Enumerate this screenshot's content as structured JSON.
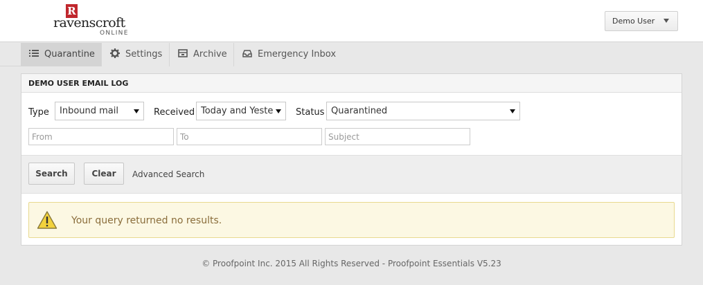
{
  "header": {
    "logo": {
      "mark": "R",
      "word": "ravenscroft",
      "sub": "ONLINE"
    },
    "user_menu": {
      "label": "Demo User",
      "icon": "caret-down-icon"
    }
  },
  "nav": {
    "tabs": [
      {
        "label": "Quarantine",
        "icon": "list-icon",
        "active": true
      },
      {
        "label": "Settings",
        "icon": "gear-icon",
        "active": false
      },
      {
        "label": "Archive",
        "icon": "archive-icon",
        "active": false
      },
      {
        "label": "Emergency Inbox",
        "icon": "inbox-icon",
        "active": false
      }
    ]
  },
  "panel": {
    "title": "DEMO USER EMAIL LOG",
    "filters": {
      "type": {
        "label": "Type",
        "value": "Inbound mail"
      },
      "received": {
        "label": "Received",
        "value": "Today and Yesterday"
      },
      "status": {
        "label": "Status",
        "value": "Quarantined"
      }
    },
    "fields": {
      "from": {
        "placeholder": "From",
        "value": ""
      },
      "to": {
        "placeholder": "To",
        "value": ""
      },
      "subject": {
        "placeholder": "Subject",
        "value": ""
      }
    },
    "actions": {
      "search": "Search",
      "clear": "Clear",
      "advanced": "Advanced Search"
    },
    "alert": {
      "icon": "warning-icon",
      "message": "Your query returned no results."
    }
  },
  "footer": "© Proofpoint Inc. 2015 All Rights Reserved - Proofpoint Essentials V5.23",
  "colors": {
    "alert_background": "#fcf8e3",
    "alert_text": "#8a6d3b",
    "logo_red": "#c0272d"
  }
}
